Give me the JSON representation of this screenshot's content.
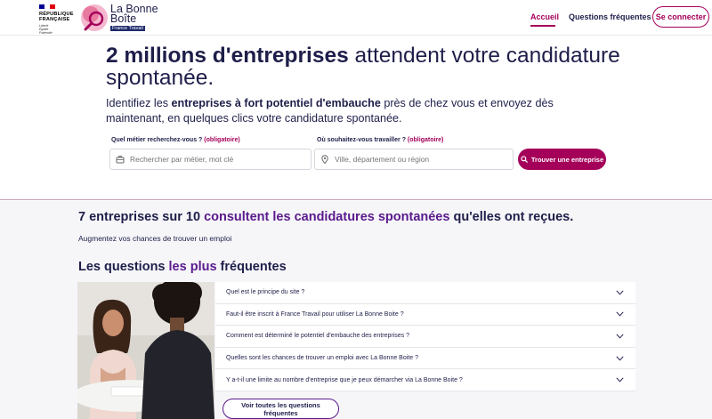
{
  "header": {
    "republic": {
      "line1": "RÉPUBLIQUE",
      "line2": "FRANÇAISE",
      "motto1": "Liberté",
      "motto2": "Égalité",
      "motto3": "Fraternité"
    },
    "brand": {
      "line1": "La Bonne",
      "line2": "Boîte",
      "badge": "France Travail"
    },
    "nav": {
      "home": "Accueil",
      "faq": "Questions fréquentes"
    },
    "login_label": "Se connecter"
  },
  "hero": {
    "title_bold": "2 millions d'entreprises",
    "title_rest": " attendent votre candidature spontanée.",
    "subtitle_pre": "Identifiez les ",
    "subtitle_bold": "entreprises à fort potentiel d'embauche",
    "subtitle_post": " près de chez vous et envoyez dès maintenant, en quelques clics votre candidature spontanée.",
    "job_label": "Quel métier recherchez-vous ?",
    "job_required": "(obligatoire)",
    "job_placeholder": "Rechercher par métier, mot clé",
    "place_label": "Où souhaitez-vous travailler ?",
    "place_required": "(obligatoire)",
    "place_placeholder": "Ville, département ou région",
    "search_label": "Trouver une entreprise"
  },
  "stats": {
    "bold": "7 entreprises sur 10",
    "highlight": "consultent les candidatures spontanées",
    "rest": " qu'elles ont reçues.",
    "sub": "Augmentez vos chances de trouver un emploi"
  },
  "faq": {
    "title_pre": "Les questions ",
    "title_highlight": "les plus",
    "title_post": " fréquentes",
    "items": [
      "Quel est le principe du site ?",
      "Faut-il être inscrit à France Travail pour utiliser La Bonne Boite ?",
      "Comment est déterminé le potentiel d'embauche des entreprises ?",
      "Quelles sont les chances de trouver un emploi avec La Bonne Boite ?",
      "Y a-t-il une limite au nombre d'entreprise que je peux démarcher via La Bonne Boite ?"
    ],
    "all_label": "Voir toutes les questions fréquentes"
  },
  "colors": {
    "accent": "#a4005a",
    "navy": "#1e1e4a",
    "purple": "#5a1a8c"
  }
}
